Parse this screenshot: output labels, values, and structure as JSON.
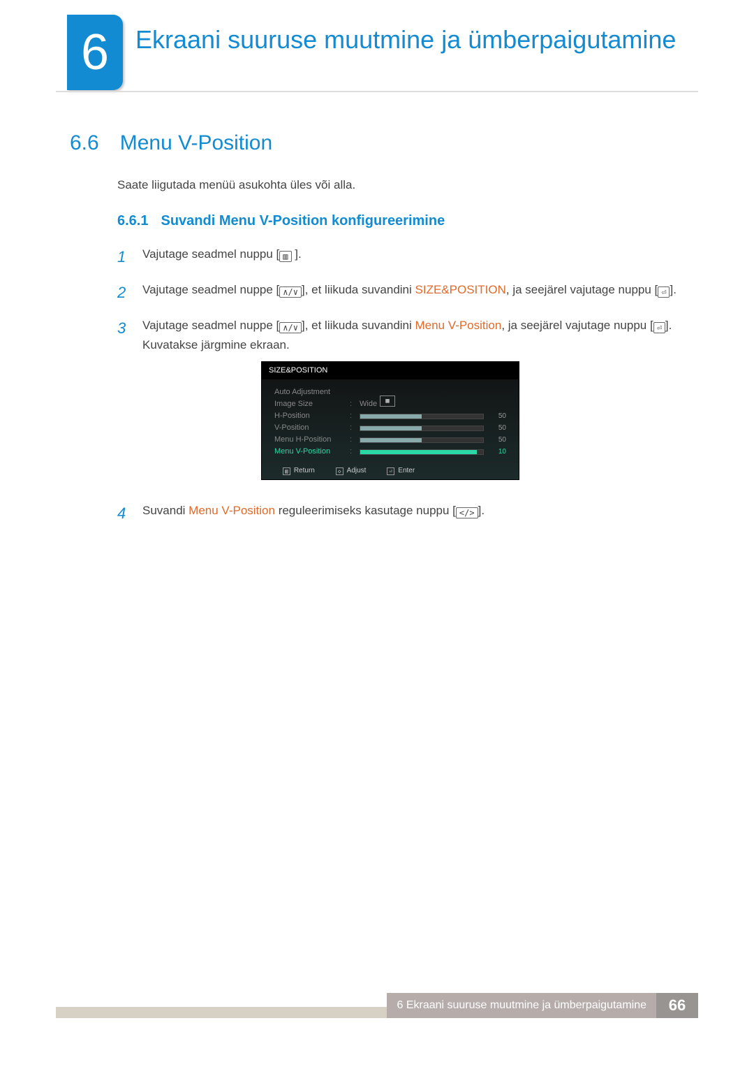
{
  "chapter": {
    "number": "6",
    "title": "Ekraani suuruse muutmine ja ümberpaigutamine"
  },
  "section": {
    "number": "6.6",
    "title": "Menu V-Position",
    "description": "Saate liigutada menüü asukohta üles või alla."
  },
  "subsection": {
    "number": "6.6.1",
    "title": "Suvandi Menu V-Position konfigureerimine"
  },
  "steps": {
    "s1": {
      "num": "1",
      "a": "Vajutage seadmel nuppu [",
      "b": " ]."
    },
    "s2": {
      "num": "2",
      "a": "Vajutage seadmel nuppe [",
      "b": "], et liikuda suvandini ",
      "kw": "SIZE&POSITION",
      "c": ", ja seejärel vajutage nuppu [",
      "d": "]."
    },
    "s3": {
      "num": "3",
      "a": "Vajutage seadmel nuppe [",
      "b": "], et liikuda suvandini ",
      "kw": "Menu V-Position",
      "c": ", ja seejärel vajutage nuppu [",
      "d": "]. Kuvatakse järgmine ekraan."
    },
    "s4": {
      "num": "4",
      "a": "Suvandi ",
      "kw": "Menu V-Position",
      "b": " reguleerimiseks kasutage nuppu [",
      "c": "]."
    }
  },
  "osd": {
    "title": "SIZE&POSITION",
    "rows": {
      "auto": {
        "label": "Auto Adjustment"
      },
      "size": {
        "label": "Image Size",
        "value": "Wide"
      },
      "hpos": {
        "label": "H-Position",
        "value": "50",
        "pct": 50
      },
      "vpos": {
        "label": "V-Position",
        "value": "50",
        "pct": 50
      },
      "mhpos": {
        "label": "Menu H-Position",
        "value": "50",
        "pct": 50
      },
      "mvpos": {
        "label": "Menu V-Position",
        "value": "10",
        "pct": 95
      }
    },
    "footer": {
      "ret": "Return",
      "adj": "Adjust",
      "ent": "Enter"
    }
  },
  "icons": {
    "menu": "▥",
    "updown": "∧/∨",
    "enter": "⏎",
    "leftright": "</>"
  },
  "footer": {
    "text": "6 Ekraani suuruse muutmine ja ümberpaigutamine",
    "page": "66"
  }
}
